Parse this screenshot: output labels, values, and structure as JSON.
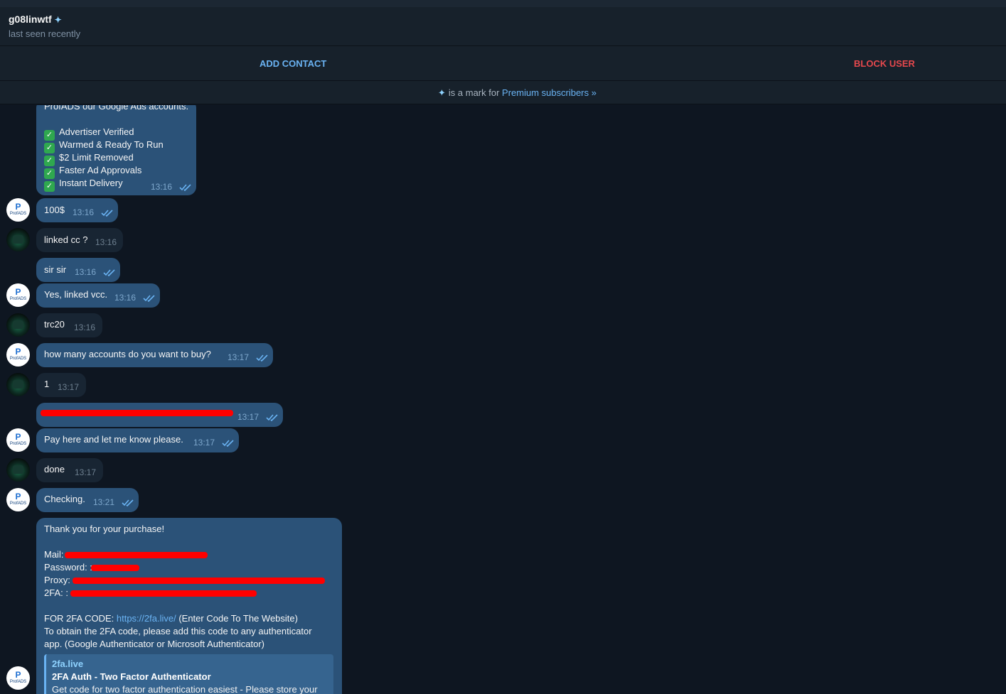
{
  "header": {
    "name": "g08linwtf",
    "status": "last seen recently"
  },
  "actions": {
    "add_contact": "ADD CONTACT",
    "block_user": "BLOCK USER"
  },
  "premium_bar": {
    "text": "is a mark for",
    "link": "Premium subscribers »"
  },
  "first_message": {
    "top_line": "ProfADS our Google Ads accounts.",
    "items": [
      "Advertiser Verified",
      "Warmed & Ready To Run",
      "$2 Limit Removed",
      "Faster Ad Approvals",
      "Instant Delivery"
    ],
    "check_glyph": "✓",
    "time": "13:16"
  },
  "messages": [
    {
      "text": "100$",
      "time": "13:16",
      "out": true,
      "avatar": "profads"
    },
    {
      "text": "linked cc ?",
      "time": "13:16",
      "out": false,
      "avatar": "user"
    },
    {
      "text": "sir sir",
      "time": "13:16",
      "out": true,
      "avatar": ""
    },
    {
      "text": "Yes, linked vcc.",
      "time": "13:16",
      "out": true,
      "avatar": "profads"
    },
    {
      "text": "trc20",
      "time": "13:16",
      "out": false,
      "avatar": "user"
    },
    {
      "text": "how many accounts do you want to buy?",
      "time": "13:17",
      "out": true,
      "avatar": "profads"
    },
    {
      "text": "1",
      "time": "13:17",
      "out": false,
      "avatar": "user"
    },
    {
      "text": "",
      "time": "13:17",
      "out": true,
      "avatar": "",
      "redacted": true
    },
    {
      "text": "Pay here and let me know please.",
      "time": "13:17",
      "out": true,
      "avatar": "profads"
    },
    {
      "text": "done",
      "time": "13:17",
      "out": false,
      "avatar": "user"
    },
    {
      "text": "Checking.",
      "time": "13:21",
      "out": true,
      "avatar": "profads"
    }
  ],
  "purchase": {
    "thanks": "Thank you for your purchase!",
    "mail_label": "Mail:",
    "password_label": "Password: :",
    "proxy_label": "Proxy:",
    "twofa_label": "2FA: :",
    "code_prefix": "FOR 2FA CODE:",
    "code_link": "https://2fa.live/",
    "code_suffix": "(Enter Code To The Website)",
    "obtain_line1": "To obtain the 2FA code, please add this code to any authenticator",
    "obtain_line2": "app. (Google Authenticator or Microsoft Authenticator)",
    "preview_site": "2fa.live",
    "preview_title": "2FA Auth - Two Factor Authenticator",
    "preview_desc": "Get code for two factor authentication easiest - Please store your"
  },
  "avatar_labels": {
    "profads_mark": "P",
    "profads_text": "ProfADS"
  },
  "colors": {
    "background": "#0e1621",
    "panel": "#17212b",
    "outgoing_bubble": "#2b5278",
    "incoming_bubble": "#182533",
    "link": "#6ab3f3",
    "danger": "#e5484d",
    "redaction": "#ff0000"
  }
}
